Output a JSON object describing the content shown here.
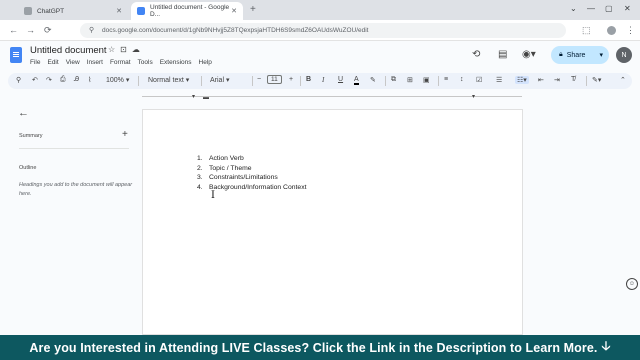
{
  "browser": {
    "tabs": [
      {
        "title": "ChatGPT",
        "favicon_color": "#9aa0a6"
      },
      {
        "title": "Untitled document - Google D...",
        "favicon_color": "#4285f4"
      }
    ],
    "close_glyph": "✕",
    "new_tab_glyph": "+",
    "window_controls": [
      "⌄",
      "—",
      "▢",
      "✕"
    ],
    "url": "docs.google.com/document/d/1gNb9NHvjj5Z8TQexpsjaHTDH6S9smdZ6OAUdsWuZOU/edit",
    "nav": [
      "←",
      "→",
      "⟳"
    ]
  },
  "doc": {
    "title": "Untitled document",
    "title_icons": [
      "☆",
      "⊡",
      "☁"
    ],
    "menus": [
      "File",
      "Edit",
      "View",
      "Insert",
      "Format",
      "Tools",
      "Extensions",
      "Help"
    ],
    "share_label": "Share",
    "avatar_letter": "N"
  },
  "toolbar": {
    "zoom": "100%",
    "style": "Normal text",
    "font": "Arial",
    "font_size": "11",
    "buttons": [
      "B",
      "I",
      "U",
      "A"
    ]
  },
  "sidebar": {
    "summary_label": "Summary",
    "outline_label": "Outline",
    "outline_hint": "Headings you add to the document will appear here."
  },
  "document_list": [
    {
      "num": "1.",
      "text": "Action Verb"
    },
    {
      "num": "2.",
      "text": "Topic / Theme"
    },
    {
      "num": "3.",
      "text": "Constraints/Limitations"
    },
    {
      "num": "4.",
      "text": "Background/Information Context"
    }
  ],
  "banner": {
    "text": "Are you Interested in Attending LIVE Classes? Click the Link in the Description to Learn More.",
    "arrow": "🡣"
  }
}
